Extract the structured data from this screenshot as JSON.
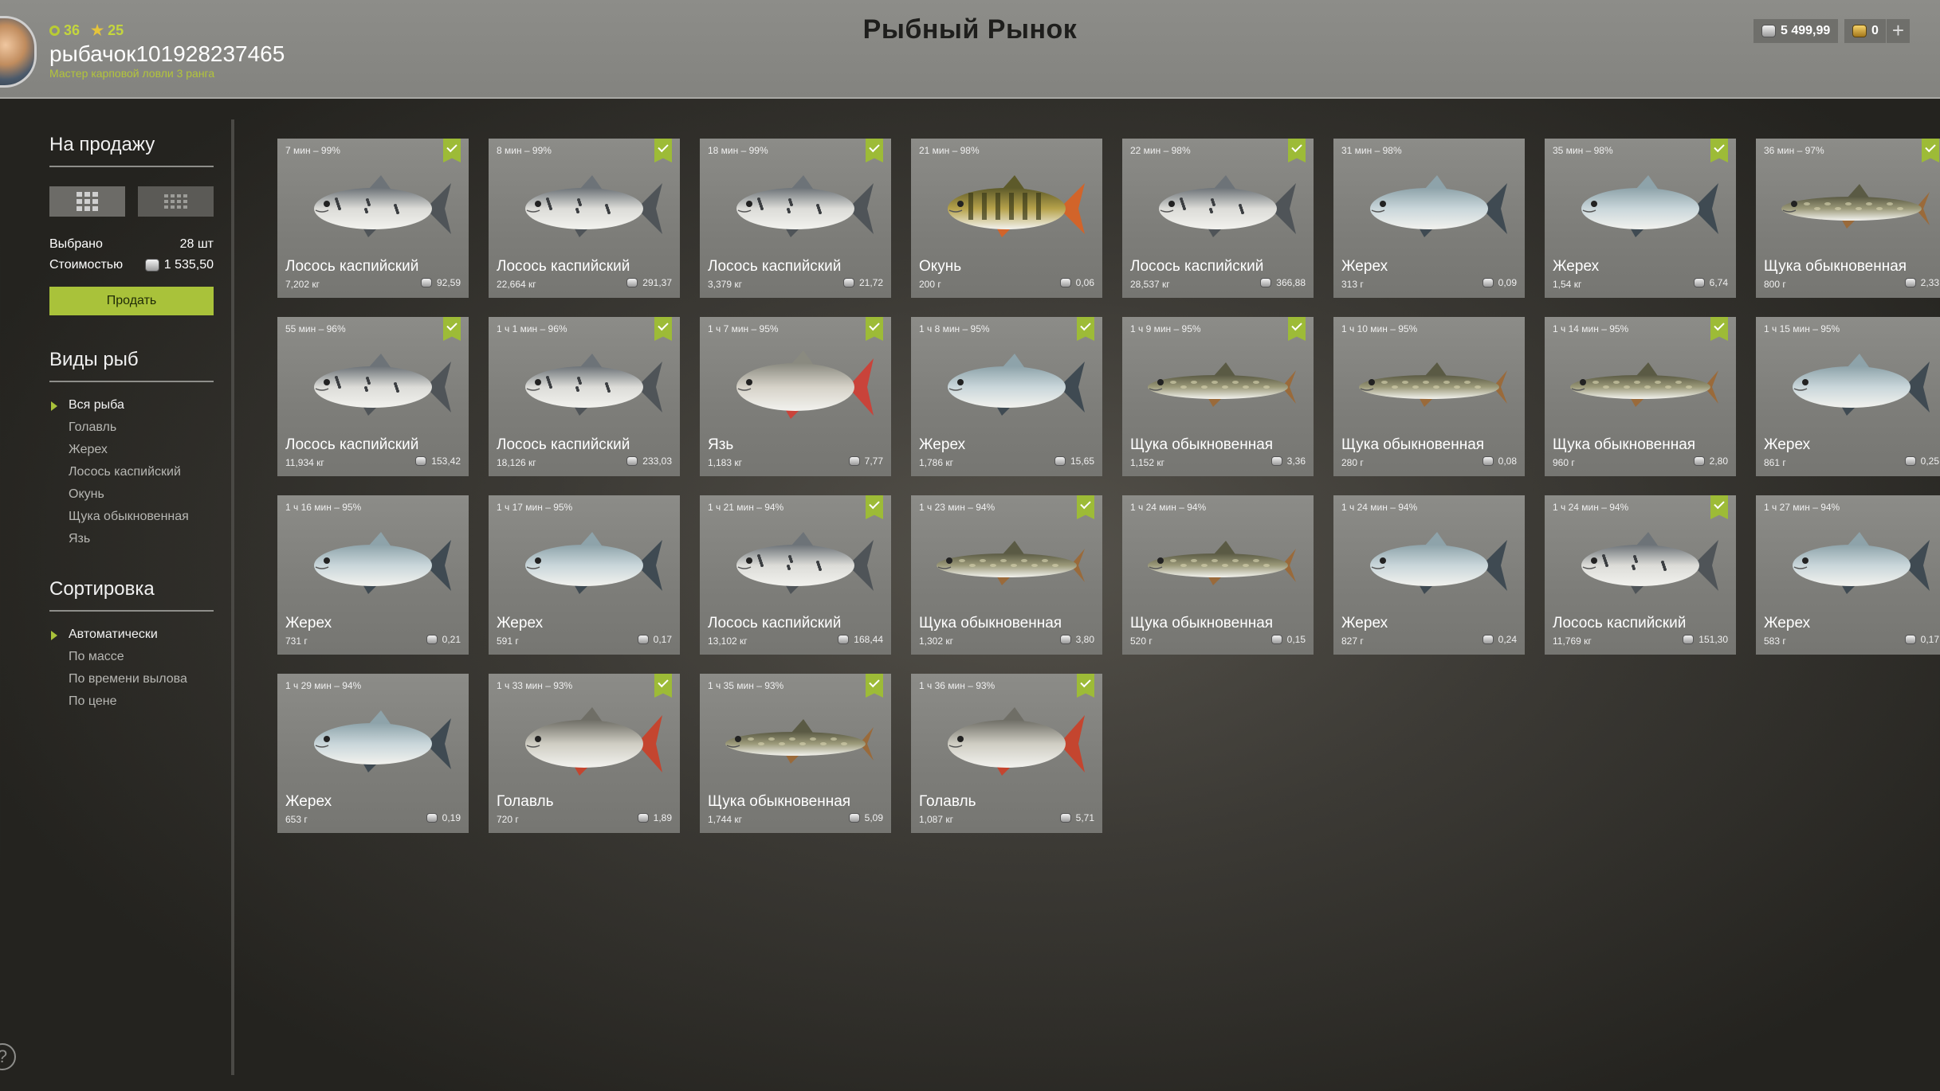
{
  "player": {
    "level": "36",
    "stars": "25",
    "username": "рыбачок101928237465",
    "rank": "Мастер карповой ловли 3 ранга"
  },
  "header": {
    "title": "Рыбный Рынок"
  },
  "wallet": {
    "silver": "5 499,99",
    "gold": "0",
    "add_label": "+"
  },
  "sidebar": {
    "for_sale_title": "На продажу",
    "selected_label": "Выбрано",
    "selected_value": "28 шт",
    "cost_label": "Стоимостью",
    "cost_value": "1 535,50",
    "sell_label": "Продать",
    "species_title": "Виды рыб",
    "species": [
      "Вся рыба",
      "Голавль",
      "Жерех",
      "Лосось каспийский",
      "Окунь",
      "Щука обыкновенная",
      "Язь"
    ],
    "sort_title": "Сортировка",
    "sort": [
      "Автоматически",
      "По массе",
      "По времени вылова",
      "По цене"
    ]
  },
  "help_label": "?",
  "fish": [
    {
      "time": "7 мин – 99%",
      "name": "Лосось каспийский",
      "weight": "7,202 кг",
      "price": "92,59",
      "checked": true,
      "kind": "salmon"
    },
    {
      "time": "8 мин – 99%",
      "name": "Лосось каспийский",
      "weight": "22,664 кг",
      "price": "291,37",
      "checked": true,
      "kind": "salmon"
    },
    {
      "time": "18 мин – 99%",
      "name": "Лосось каспийский",
      "weight": "3,379 кг",
      "price": "21,72",
      "checked": true,
      "kind": "salmon"
    },
    {
      "time": "21 мин – 98%",
      "name": "Окунь",
      "weight": "200 г",
      "price": "0,06",
      "checked": false,
      "kind": "perch"
    },
    {
      "time": "22 мин – 98%",
      "name": "Лосось каспийский",
      "weight": "28,537 кг",
      "price": "366,88",
      "checked": true,
      "kind": "salmon"
    },
    {
      "time": "31 мин – 98%",
      "name": "Жерех",
      "weight": "313 г",
      "price": "0,09",
      "checked": false,
      "kind": "asp"
    },
    {
      "time": "35 мин – 98%",
      "name": "Жерех",
      "weight": "1,54 кг",
      "price": "6,74",
      "checked": true,
      "kind": "asp"
    },
    {
      "time": "36 мин – 97%",
      "name": "Щука обыкновенная",
      "weight": "800 г",
      "price": "2,33",
      "checked": true,
      "kind": "pike"
    },
    {
      "time": "55 мин – 96%",
      "name": "Лосось каспийский",
      "weight": "11,934 кг",
      "price": "153,42",
      "checked": true,
      "kind": "salmon"
    },
    {
      "time": "1 ч 1 мин – 96%",
      "name": "Лосось каспийский",
      "weight": "18,126 кг",
      "price": "233,03",
      "checked": true,
      "kind": "salmon"
    },
    {
      "time": "1 ч 7 мин – 95%",
      "name": "Язь",
      "weight": "1,183 кг",
      "price": "7,77",
      "checked": true,
      "kind": "ide"
    },
    {
      "time": "1 ч 8 мин – 95%",
      "name": "Жерех",
      "weight": "1,786 кг",
      "price": "15,65",
      "checked": true,
      "kind": "asp"
    },
    {
      "time": "1 ч 9 мин – 95%",
      "name": "Щука обыкновенная",
      "weight": "1,152 кг",
      "price": "3,36",
      "checked": true,
      "kind": "pike"
    },
    {
      "time": "1 ч 10 мин – 95%",
      "name": "Щука обыкновенная",
      "weight": "280 г",
      "price": "0,08",
      "checked": false,
      "kind": "pike"
    },
    {
      "time": "1 ч 14 мин – 95%",
      "name": "Щука обыкновенная",
      "weight": "960 г",
      "price": "2,80",
      "checked": true,
      "kind": "pike"
    },
    {
      "time": "1 ч 15 мин – 95%",
      "name": "Жерех",
      "weight": "861 г",
      "price": "0,25",
      "checked": false,
      "kind": "asp"
    },
    {
      "time": "1 ч 16 мин – 95%",
      "name": "Жерех",
      "weight": "731 г",
      "price": "0,21",
      "checked": false,
      "kind": "asp"
    },
    {
      "time": "1 ч 17 мин – 95%",
      "name": "Жерех",
      "weight": "591 г",
      "price": "0,17",
      "checked": false,
      "kind": "asp"
    },
    {
      "time": "1 ч 21 мин – 94%",
      "name": "Лосось каспийский",
      "weight": "13,102 кг",
      "price": "168,44",
      "checked": true,
      "kind": "salmon"
    },
    {
      "time": "1 ч 23 мин – 94%",
      "name": "Щука обыкновенная",
      "weight": "1,302 кг",
      "price": "3,80",
      "checked": true,
      "kind": "pike"
    },
    {
      "time": "1 ч 24 мин – 94%",
      "name": "Щука обыкновенная",
      "weight": "520 г",
      "price": "0,15",
      "checked": false,
      "kind": "pike"
    },
    {
      "time": "1 ч 24 мин – 94%",
      "name": "Жерех",
      "weight": "827 г",
      "price": "0,24",
      "checked": false,
      "kind": "asp"
    },
    {
      "time": "1 ч 24 мин – 94%",
      "name": "Лосось каспийский",
      "weight": "11,769 кг",
      "price": "151,30",
      "checked": true,
      "kind": "salmon"
    },
    {
      "time": "1 ч 27 мин – 94%",
      "name": "Жерех",
      "weight": "583 г",
      "price": "0,17",
      "checked": false,
      "kind": "asp"
    },
    {
      "time": "1 ч 29 мин – 94%",
      "name": "Жерех",
      "weight": "653 г",
      "price": "0,19",
      "checked": false,
      "kind": "asp"
    },
    {
      "time": "1 ч 33 мин – 93%",
      "name": "Голавль",
      "weight": "720 г",
      "price": "1,89",
      "checked": true,
      "kind": "chub"
    },
    {
      "time": "1 ч 35 мин – 93%",
      "name": "Щука обыкновенная",
      "weight": "1,744 кг",
      "price": "5,09",
      "checked": true,
      "kind": "pike"
    },
    {
      "time": "1 ч 36 мин – 93%",
      "name": "Голавль",
      "weight": "1,087 кг",
      "price": "5,71",
      "checked": true,
      "kind": "chub"
    }
  ]
}
